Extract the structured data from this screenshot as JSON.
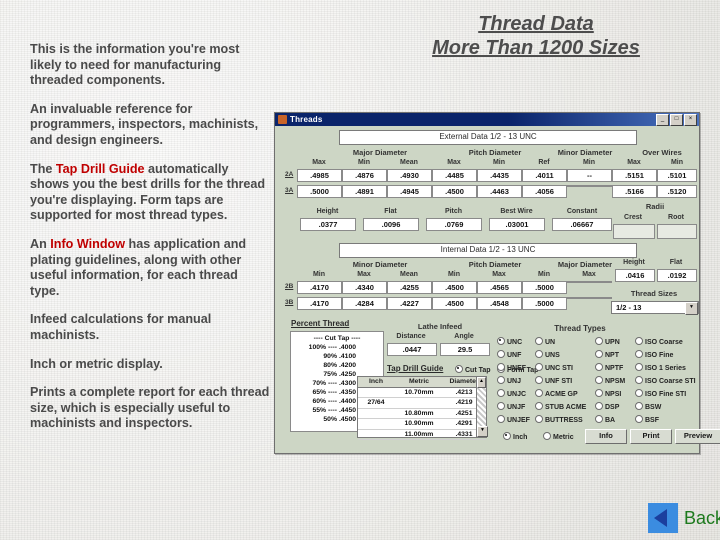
{
  "slide": {
    "title_line1": "Thread Data",
    "title_line2": "More Than 1200 Sizes",
    "paragraphs": [
      "This is the information you're most likely to need for manufacturing threaded components.",
      "An invaluable reference for programmers, inspectors, machinists, and design engineers.",
      "Infeed calculations for manual machinists.",
      "Inch or metric display.",
      "Prints a complete report for each thread size, which is especially useful to machinists and inspectors."
    ],
    "para_tap_pre": "The ",
    "para_tap_hl": "Tap Drill Guide",
    "para_tap_post": " automatically shows you the best drills for the thread you're displaying.  Form taps are supported for most thread types.",
    "para_info_pre": "An ",
    "para_info_hl": "Info Window",
    "para_info_post": " has application and plating guidelines, along with other useful information, for each thread type.",
    "back_label": "Back",
    "accent_red": "#c00000",
    "accent_blue": "#3b8ce0",
    "accent_green": "#1d7a1d"
  },
  "app": {
    "window_title": "Threads",
    "window_buttons": [
      "_",
      "□",
      "×"
    ],
    "external": {
      "banner": "External Data     1/2 - 13  UNC",
      "groups": [
        "Major Diameter",
        "Pitch Diameter",
        "Minor Diameter",
        "Over Wires"
      ],
      "headers": [
        "Max",
        "Min",
        "Mean",
        "Max",
        "Min",
        "Ref",
        "Min",
        "Max",
        "Min"
      ],
      "rows": [
        {
          "label": "2A",
          "cells": [
            ".4985",
            ".4876",
            ".4930",
            ".4485",
            ".4435",
            ".4011",
            "--",
            ".5151",
            ".5101"
          ]
        },
        {
          "label": "3A",
          "cells": [
            ".5000",
            ".4891",
            ".4945",
            ".4500",
            ".4463",
            ".4056",
            "",
            ".5166",
            ".5120"
          ]
        }
      ]
    },
    "middle": {
      "labels": [
        "Height",
        "Flat",
        "Pitch",
        "Best Wire",
        "Constant"
      ],
      "values": [
        ".0377",
        ".0096",
        ".0769",
        ".03001",
        ".06667"
      ],
      "radii_group": "Radii",
      "radii_labels": [
        "Crest",
        "Root"
      ],
      "radii_values": [
        "",
        ""
      ]
    },
    "internal": {
      "banner": "Internal Data     1/2 - 13  UNC",
      "groups": [
        "Minor Diameter",
        "Pitch Diameter",
        "Major Diameter"
      ],
      "headers": [
        "Min",
        "Max",
        "Mean",
        "Min",
        "Max",
        "Min",
        "Max"
      ],
      "rows": [
        {
          "label": "2B",
          "cells": [
            ".4170",
            ".4340",
            ".4255",
            ".4500",
            ".4565",
            ".5000",
            ""
          ]
        },
        {
          "label": "3B",
          "cells": [
            ".4170",
            ".4284",
            ".4227",
            ".4500",
            ".4548",
            ".5000",
            ""
          ]
        }
      ],
      "side_labels": [
        "Height",
        "Flat"
      ],
      "side_values": [
        ".0416",
        ".0192"
      ],
      "thread_sizes_label": "Thread Sizes",
      "thread_sizes_value": "1/2 - 13"
    },
    "percent_thread": {
      "title": "Percent Thread",
      "head": "---- Cut Tap ----",
      "rows": [
        {
          "pct": "100% ----",
          "val": ".4000"
        },
        {
          "pct": "90%",
          "val": ".4100"
        },
        {
          "pct": "80%",
          "val": ".4200"
        },
        {
          "pct": "75%",
          "val": ".4250"
        },
        {
          "pct": "70% ----",
          "val": ".4300"
        },
        {
          "pct": "65% ----",
          "val": ".4350"
        },
        {
          "pct": "60% ----",
          "val": ".4400"
        },
        {
          "pct": "55% ----",
          "val": ".4450"
        },
        {
          "pct": "50%",
          "val": ".4500"
        }
      ]
    },
    "lathe_infeed": {
      "title": "Lathe Infeed",
      "labels": [
        "Distance",
        "Angle"
      ],
      "values": [
        ".0447",
        "29.5"
      ]
    },
    "tap_drill": {
      "title": "Tap Drill Guide",
      "options": [
        "Cut Tap",
        "Form Tap"
      ],
      "selected": "Cut Tap",
      "columns": [
        "Inch",
        "Metric",
        "Diameter"
      ],
      "rows": [
        {
          "inch": "",
          "metric": "10.70mm",
          "diameter": ".4213"
        },
        {
          "inch": "27/64",
          "metric": "",
          "diameter": ".4219"
        },
        {
          "inch": "",
          "metric": "10.80mm",
          "diameter": ".4251"
        },
        {
          "inch": "",
          "metric": "10.90mm",
          "diameter": ".4291"
        },
        {
          "inch": "",
          "metric": "11.00mm",
          "diameter": ".4331"
        }
      ]
    },
    "thread_types": {
      "title": "Thread Types",
      "selected": "UNC",
      "columns": [
        [
          "UNC",
          "UNF",
          "UNEF",
          "UNJ",
          "UNJC",
          "UNJF",
          "UNJEF"
        ],
        [
          "UN",
          "UNS",
          "UNC STI",
          "UNF STI",
          "ACME GP",
          "STUB ACME",
          "BUTTRESS"
        ],
        [
          "UPN",
          "NPT",
          "NPTF",
          "NPSM",
          "NPSI",
          "DSP",
          "BA"
        ],
        [
          "ISO Coarse",
          "ISO Fine",
          "ISO 1 Series",
          "ISO Coarse STI",
          "ISO Fine STI",
          "BSW",
          "BSF"
        ]
      ]
    },
    "units": {
      "options": [
        "Inch",
        "Metric"
      ],
      "selected": "Inch"
    },
    "buttons": [
      "Info",
      "Print",
      "Preview"
    ]
  }
}
